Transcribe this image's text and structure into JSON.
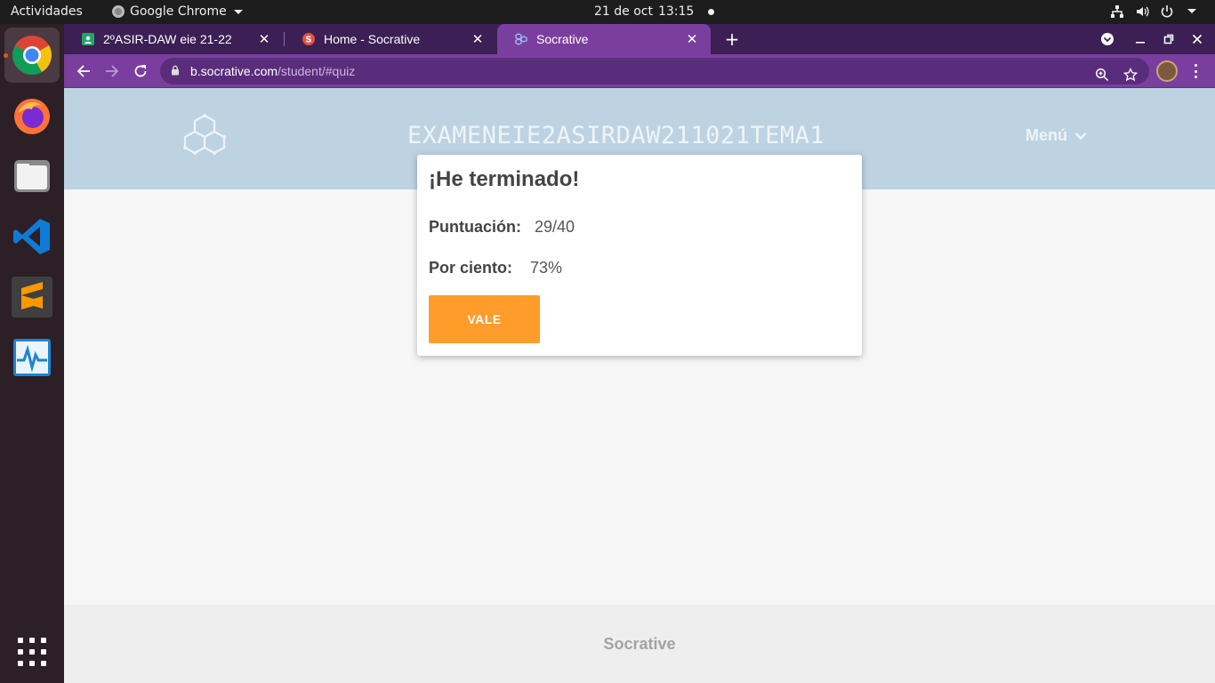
{
  "topbar": {
    "activities": "Actividades",
    "app_name": "Google Chrome",
    "date": "21 de oct",
    "time": "13:15"
  },
  "dock": {
    "items": [
      {
        "icon": "chrome-icon",
        "active": true
      },
      {
        "icon": "firefox-icon"
      },
      {
        "icon": "files-icon"
      },
      {
        "icon": "vscode-icon"
      },
      {
        "icon": "sublime-text-icon"
      },
      {
        "icon": "system-monitor-icon"
      }
    ]
  },
  "tabs": [
    {
      "title": "2ºASIR-DAW eie 21-22",
      "favicon": "classroom-icon"
    },
    {
      "title": "Home - Socrative",
      "favicon": "socrative-s-icon"
    },
    {
      "title": "Socrative",
      "favicon": "socrative-hex-icon",
      "active": true
    }
  ],
  "address_bar": {
    "host": "b.socrative.com",
    "path": "/student/#quiz"
  },
  "socrative": {
    "room_title": "EXAMENEIE2ASIRDAW211021TEMA1",
    "menu_label": "Menú",
    "footer": "Socrative"
  },
  "modal": {
    "title": "¡He terminado!",
    "score_label": "Puntuación:",
    "score_value": "29/40",
    "percent_label": "Por ciento:",
    "percent_value": "73%",
    "button_label": "VALE"
  },
  "colors": {
    "tab_strip": "#3b1f55",
    "toolbar": "#7a3f9e",
    "header": "#bdd3e1",
    "button": "#ff9c2a"
  }
}
